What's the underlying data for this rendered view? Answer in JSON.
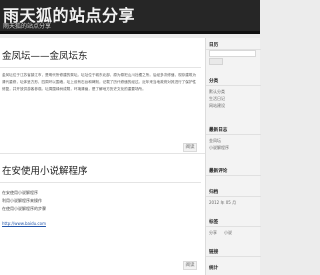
{
  "site": {
    "title": "雨天狐的站点分享",
    "description": "雨天狐的站点分享"
  },
  "posts": [
    {
      "title": "金凤坛——金凤坛东",
      "excerpt": "金凤坛位于江苏省镇江市，是明代所修建的祭坛。坛址位于城东北部，原为祭祀山川社稷之所。后经多次修缮，现存建筑为清代重修，坛体呈方形，四周环以围墙，坛上设有石台和碑刻，记载了历代修缮的经过。近年来当地政府对其进行了保护性修复，并开放供游客参观。坛周围绿树成荫，环境清幽，是了解地方历史文化的重要场所。",
      "more": "阅读"
    },
    {
      "title": "在安使用小说解程序",
      "lines": [
        "在安使用小说解程序",
        "利用小说解程序来操作",
        "在使用小说解程序的步骤",
        "http://www.baidu.com"
      ],
      "more": "阅读"
    }
  ],
  "sidebar": {
    "widgets": [
      {
        "title": "日历",
        "items": []
      },
      {
        "title": "分类",
        "items": [
          "默认分类",
          "生活日记",
          "网站建设"
        ]
      },
      {
        "title": "最新日志",
        "items": [
          "金凤坛",
          "小说解程序"
        ]
      },
      {
        "title": "最新评论",
        "items": []
      },
      {
        "title": "归档",
        "items": [
          "2012 年 05 月"
        ]
      },
      {
        "title": "标签",
        "items": [
          "分享",
          "小说"
        ]
      },
      {
        "title": "链接",
        "items": []
      },
      {
        "title": "统计",
        "items": []
      }
    ]
  }
}
